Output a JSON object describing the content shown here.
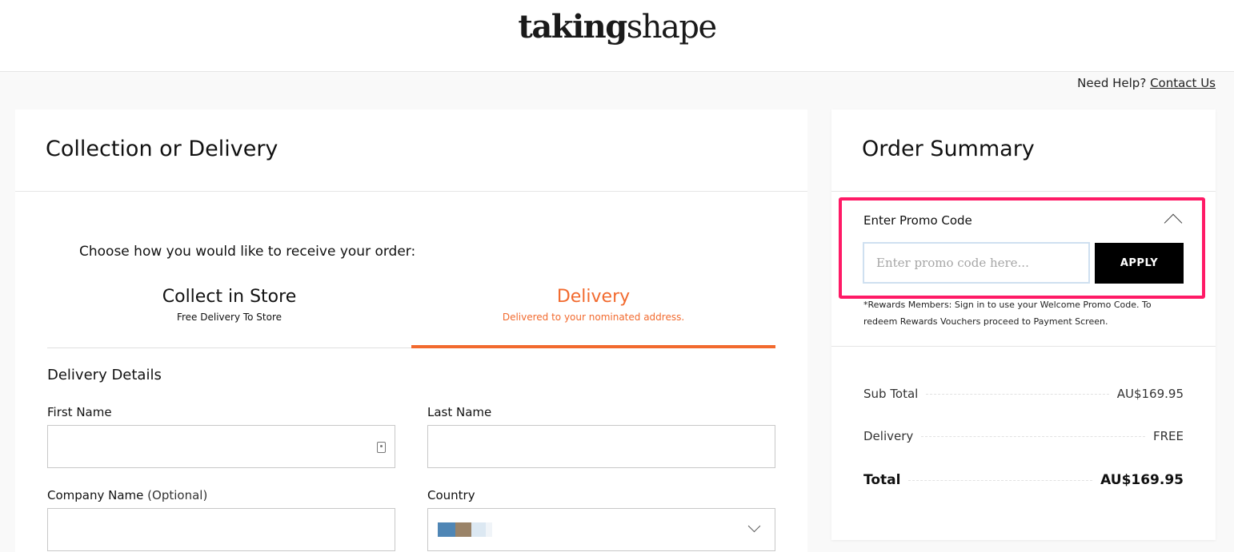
{
  "logo": {
    "bold": "taking",
    "light": "shape"
  },
  "help": {
    "text": "Need Help?",
    "link": "Contact Us"
  },
  "left": {
    "title": "Collection or Delivery",
    "choose": "Choose how you would like to receive your order:",
    "tabs": [
      {
        "title": "Collect in Store",
        "sub": "Free Delivery To Store"
      },
      {
        "title": "Delivery",
        "sub": "Delivered to your nominated address."
      }
    ],
    "section": "Delivery Details",
    "fields": {
      "first_name": "First Name",
      "last_name": "Last Name",
      "company": "Company Name",
      "company_opt": "(Optional)",
      "country": "Country"
    },
    "colors": {
      "accent": "#f26a2e"
    }
  },
  "summary": {
    "title": "Order Summary",
    "promo_title": "Enter Promo Code",
    "promo_placeholder": "Enter promo code here...",
    "apply": "APPLY",
    "note": "*Rewards Members: Sign in to use your Welcome Promo Code. To redeem Rewards Vouchers proceed to Payment Screen.",
    "rows": [
      {
        "label": "Sub Total",
        "value": "AU$169.95"
      },
      {
        "label": "Delivery",
        "value": "FREE"
      },
      {
        "label": "Total",
        "value": "AU$169.95"
      }
    ],
    "colors": {
      "highlight": "#ff1a66"
    }
  }
}
